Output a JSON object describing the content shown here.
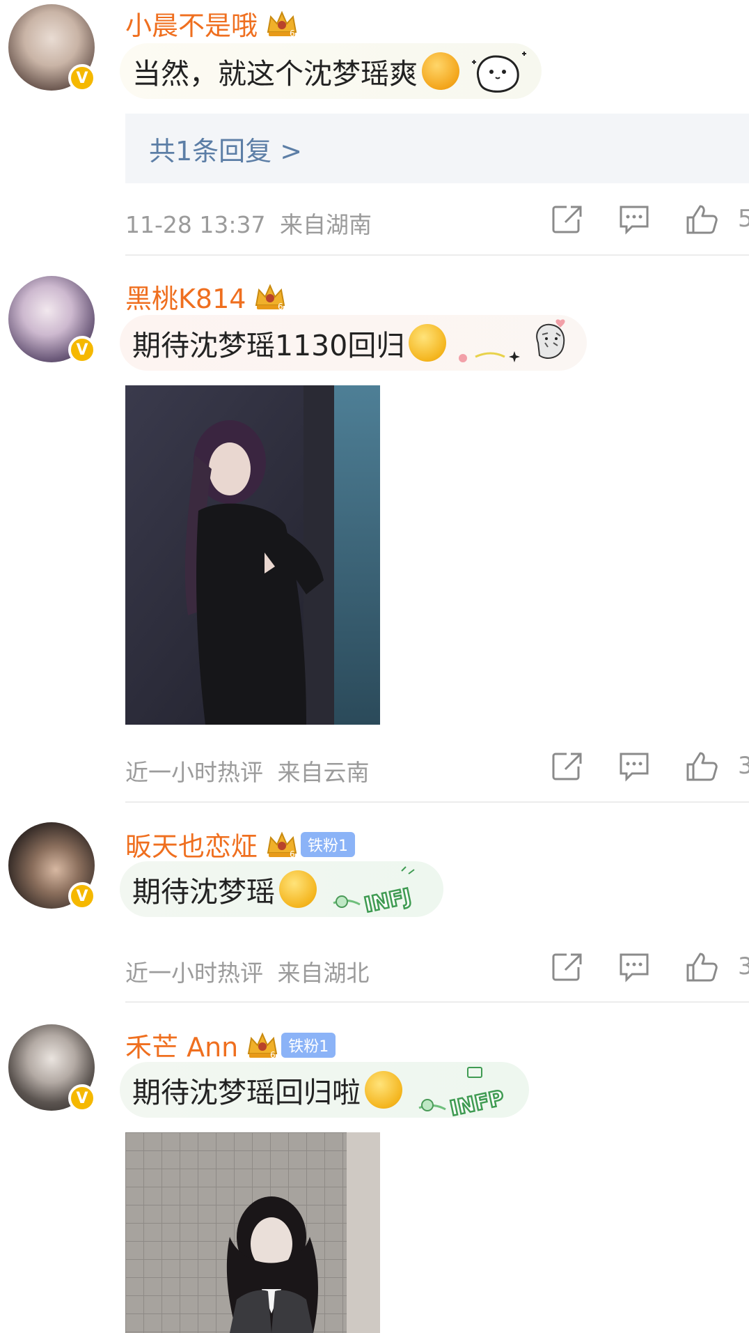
{
  "comments": [
    {
      "username": "小晨不是哦",
      "text": "当然，就这个沈梦瑶爽",
      "reply_link": "共1条回复 >",
      "time": "11-28 13:37",
      "location": "来自湖南",
      "likes": "5"
    },
    {
      "username": "黑桃K814",
      "text": "期待沈梦瑶1130回归",
      "time": "近一小时热评",
      "location": "来自云南",
      "likes": "3"
    },
    {
      "username": "昄天也恋炡",
      "fan_badge": "铁粉1",
      "text": "期待沈梦瑶",
      "decoration_text": "INFJ",
      "time": "近一小时热评",
      "location": "来自湖北",
      "likes": "3"
    },
    {
      "username": "禾芒 Ann",
      "fan_badge": "铁粉1",
      "text": "期待沈梦瑶回归啦",
      "decoration_text": "INFP"
    }
  ],
  "icons": {
    "verified": "verified-v-badge",
    "share": "share-icon",
    "comment": "comment-icon",
    "like": "thumbs-up-icon",
    "crown": "crown-level-icon"
  },
  "colors": {
    "username": "#ef6f1f",
    "reply_link": "#5c7ea6",
    "meta": "#9b9b9b",
    "verified_badge": "#f5b800",
    "fan_badge": "#8bb3f7"
  }
}
